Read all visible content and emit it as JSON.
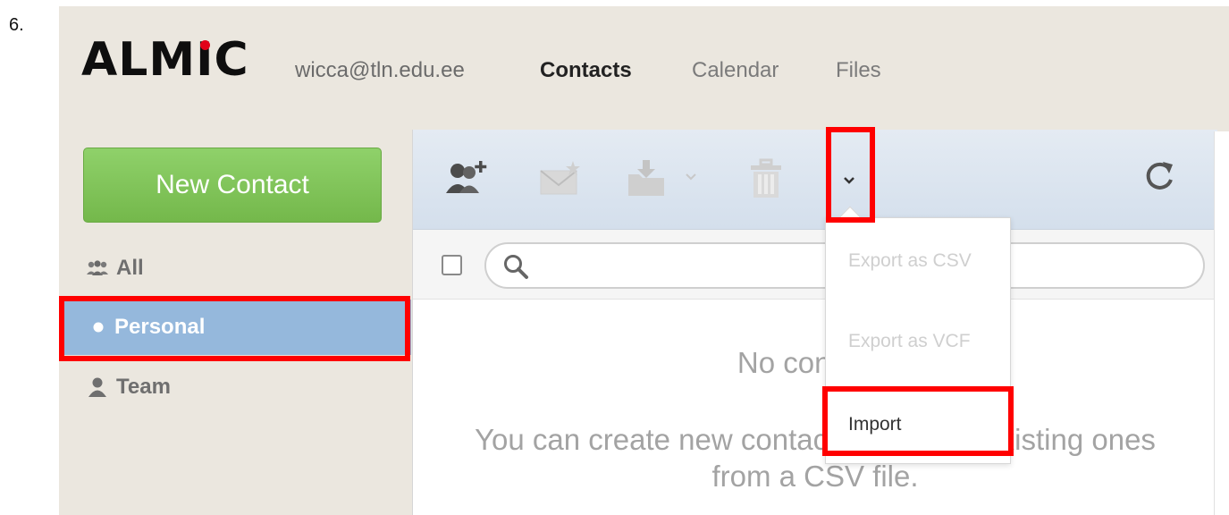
{
  "step_label": "6.",
  "header": {
    "logo": "ALMIC",
    "user_email": "wicca@tln.edu.ee",
    "nav": [
      {
        "label": "Contacts",
        "active": true
      },
      {
        "label": "Calendar",
        "active": false
      },
      {
        "label": "Files",
        "active": false
      }
    ]
  },
  "sidebar": {
    "new_contact_label": "New Contact",
    "items": [
      {
        "label": "All",
        "icon": "group-icon"
      },
      {
        "label": "Personal",
        "icon": "bullet-icon",
        "active": true
      },
      {
        "label": "Team",
        "icon": "person-icon"
      }
    ]
  },
  "toolbar": {
    "icons": [
      "add-contact-icon",
      "email-icon",
      "move-to-folder-icon",
      "chevron-down-icon",
      "trash-icon",
      "more-chevron-icon",
      "refresh-icon"
    ]
  },
  "search": {
    "placeholder": ""
  },
  "empty_state": {
    "title": "No contacts",
    "body_line1": "You can create new contacts or import existing ones",
    "body_line2": "from a CSV file."
  },
  "dropdown": {
    "items": [
      {
        "label": "Export as CSV",
        "enabled": false
      },
      {
        "label": "Export as VCF",
        "enabled": false
      },
      {
        "label": "Import",
        "enabled": true
      }
    ]
  },
  "colors": {
    "highlight": "#ff0000",
    "new_contact_button": "#7cc155",
    "active_item": "#95b8dc",
    "logo_dot": "#e2001a"
  }
}
